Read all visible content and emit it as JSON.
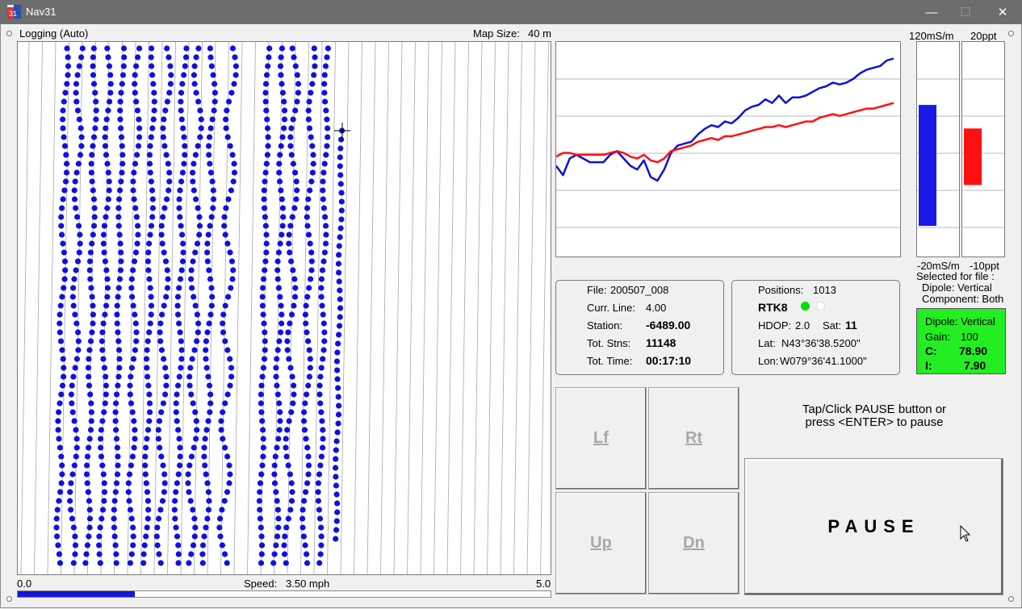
{
  "window": {
    "title": "Nav31",
    "minimize_glyph": "—",
    "maximize_glyph": "☐",
    "close_glyph": "✕"
  },
  "map": {
    "mode_label": "Logging (Auto)",
    "map_size_label": "Map Size:",
    "map_size_value": "40 m",
    "scale_min": "0.0",
    "scale_max": "5.0",
    "speed_label": "Speed:",
    "speed_value": "3.50 mph",
    "speed_progress": 0.22,
    "point_color": "#1010e0"
  },
  "gauges": {
    "cond_top": "120mS/m",
    "cond_bottom": "-20mS/m",
    "inphase_top": "20ppt",
    "inphase_bottom": "-10ppt",
    "cond_value": 78.9,
    "inphase_value": 7.9,
    "cond_color": "#1a1ae6",
    "inphase_color": "#ff1010"
  },
  "selected": {
    "heading": "Selected for file :",
    "dipole": "Dipole: Vertical",
    "component": "Component: Both"
  },
  "status": {
    "dipole": "Dipole: Vertical",
    "gain_label": "Gain:",
    "gain_value": "100",
    "c_label": "C:",
    "c_value": "78.90",
    "i_label": "I:",
    "i_value": "7.90",
    "bg_color": "#22ee22"
  },
  "file_info": {
    "file_label": "File:",
    "file_value": "200507_008",
    "line_label": "Curr. Line:",
    "line_value": "4.00",
    "station_label": "Station:",
    "station_value": "-6489.00",
    "stns_label": "Tot. Stns:",
    "stns_value": "11148",
    "time_label": "Tot. Time:",
    "time_value": "00:17:10"
  },
  "gps_info": {
    "positions_label": "Positions:",
    "positions_value": "1013",
    "fix": "RTK8",
    "hdop_label": "HDOP:",
    "hdop_value": "2.0",
    "sat_label": "Sat:",
    "sat_value": "11",
    "lat_label": "Lat:",
    "lat_value": "N43°36'38.5200\"",
    "lon_label": "Lon:",
    "lon_value": "W079°36'41.1000\"",
    "led1_color": "#00e000",
    "led2_color": "#ffffff"
  },
  "nav": {
    "left": "Lf",
    "right": "Rt",
    "up": "Up",
    "down": "Dn"
  },
  "hint": {
    "line1": "Tap/Click PAUSE button or",
    "line2": "press <ENTER> to pause"
  },
  "pause_label": "PAUSE",
  "chart_data": {
    "type": "line",
    "title": "",
    "xlabel": "",
    "ylabel": "",
    "x": [
      0,
      1,
      2,
      3,
      4,
      5,
      6,
      7,
      8,
      9,
      10,
      11,
      12,
      13,
      14,
      15,
      16,
      17,
      18,
      19,
      20,
      21,
      22,
      23,
      24,
      25,
      26,
      27,
      28,
      29,
      30,
      31,
      32,
      33,
      34,
      35,
      36,
      37,
      38,
      39,
      40,
      41,
      42,
      43,
      44,
      45,
      46,
      47,
      48,
      49,
      50
    ],
    "ylim": [
      -2.8,
      3.0
    ],
    "grid": true,
    "series": [
      {
        "color": "#1010e0",
        "values": [
          -0.35,
          -0.6,
          -0.15,
          -0.05,
          -0.15,
          -0.25,
          -0.25,
          -0.25,
          -0.05,
          0.05,
          -0.15,
          -0.35,
          -0.45,
          -0.2,
          -0.65,
          -0.75,
          -0.45,
          0.0,
          0.2,
          0.25,
          0.3,
          0.5,
          0.65,
          0.75,
          0.7,
          0.85,
          0.8,
          0.95,
          1.15,
          1.25,
          1.3,
          1.45,
          1.35,
          1.55,
          1.35,
          1.5,
          1.5,
          1.55,
          1.65,
          1.75,
          1.8,
          1.9,
          1.85,
          1.9,
          2.0,
          2.15,
          2.25,
          2.3,
          2.35,
          2.5,
          2.55
        ]
      },
      {
        "color": "#ff1010",
        "values": [
          -0.1,
          0.0,
          0.0,
          -0.05,
          -0.05,
          -0.05,
          -0.05,
          -0.05,
          0.0,
          0.05,
          0.0,
          -0.1,
          -0.15,
          -0.05,
          -0.2,
          -0.25,
          -0.15,
          0.05,
          0.1,
          0.15,
          0.2,
          0.3,
          0.35,
          0.4,
          0.35,
          0.45,
          0.45,
          0.5,
          0.55,
          0.6,
          0.65,
          0.7,
          0.7,
          0.75,
          0.7,
          0.75,
          0.8,
          0.85,
          0.85,
          0.95,
          1.0,
          1.05,
          1.0,
          1.05,
          1.1,
          1.15,
          1.2,
          1.2,
          1.25,
          1.3,
          1.35
        ]
      }
    ]
  }
}
